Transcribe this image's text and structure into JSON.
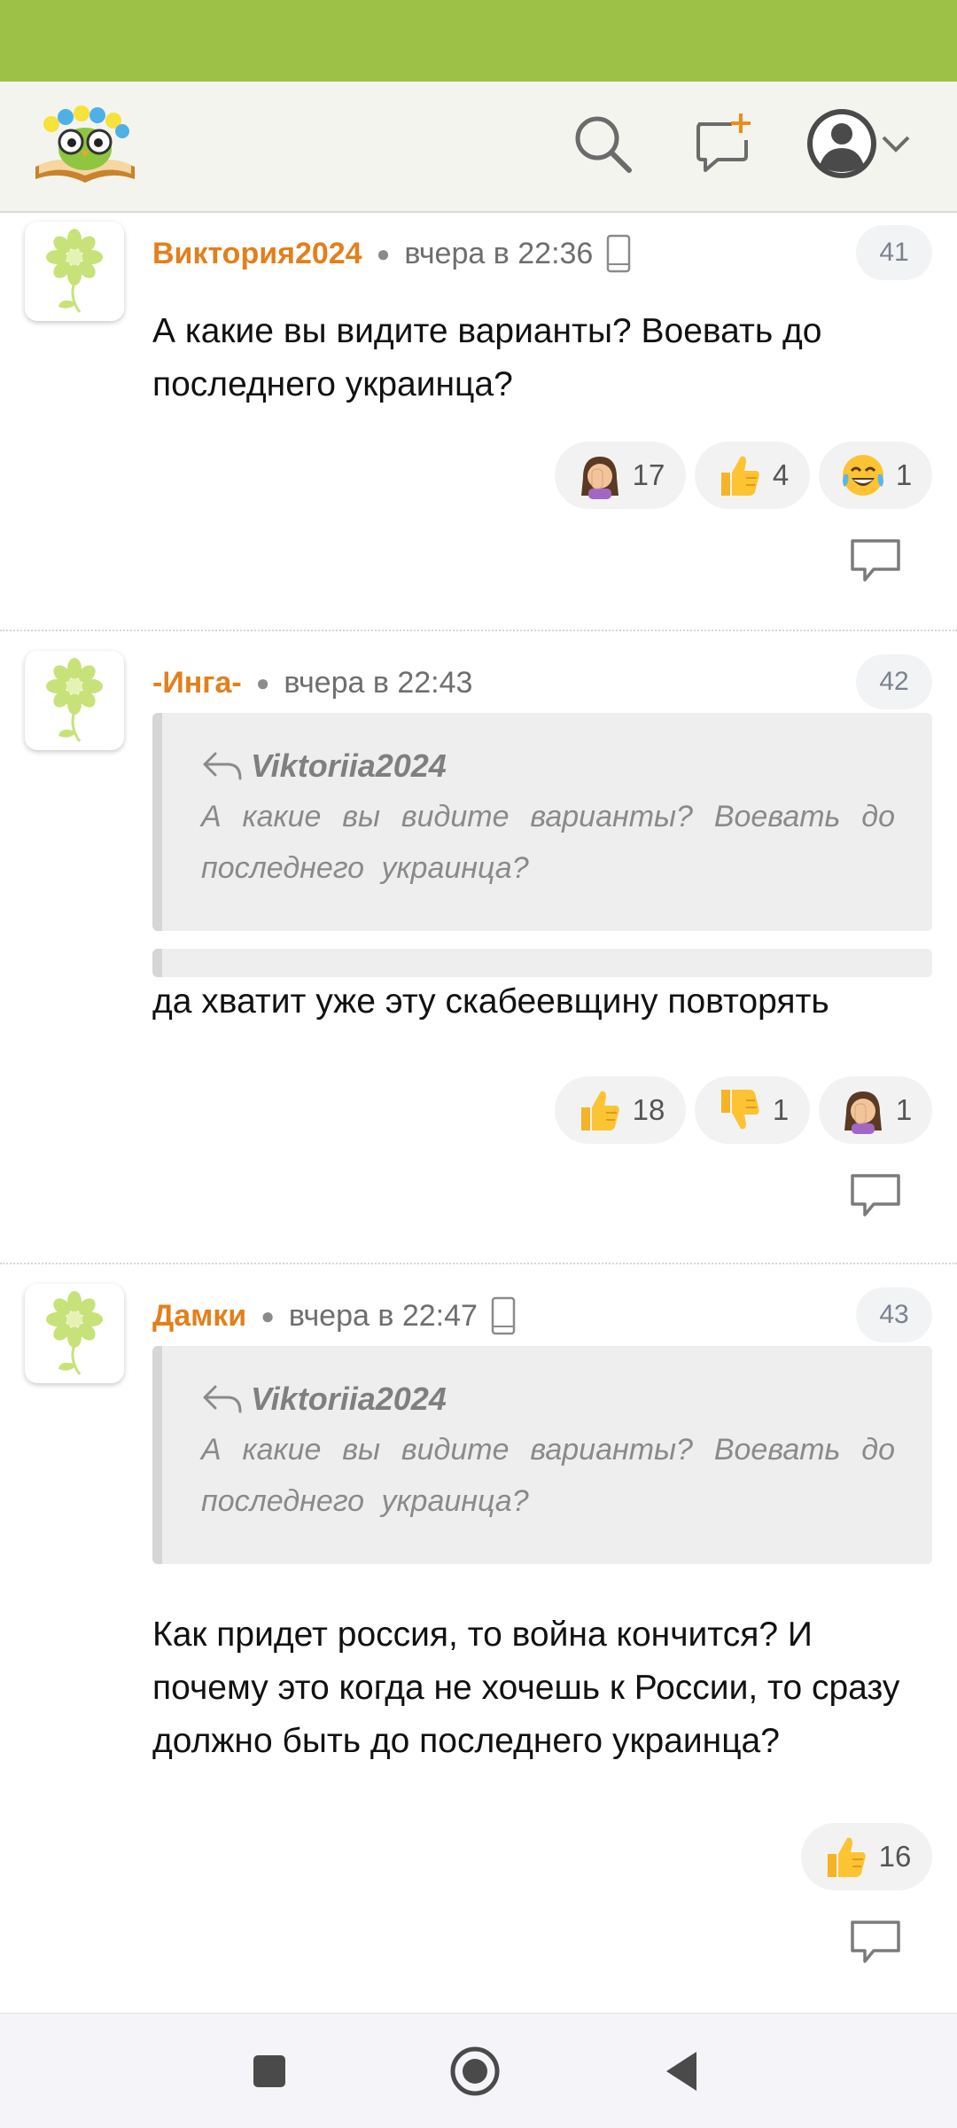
{
  "colors": {
    "statusbar": "#9dc146",
    "author": "#e2801c",
    "header_bg": "#f4f4ee"
  },
  "header": {
    "logo": "owl-on-book-logo",
    "icons": [
      "search-icon",
      "new-message-icon",
      "profile-avatar-icon",
      "chevron-down-icon"
    ]
  },
  "comments": [
    {
      "author": "Виктория2024",
      "time": "вчера в 22:36",
      "device": "phone-icon",
      "number": "41",
      "text": "А какие вы видите варианты? Воевать до последнего украинца?",
      "reactions": [
        {
          "icon": "facepalm-emoji",
          "count": "17"
        },
        {
          "icon": "thumbs-up-emoji",
          "count": "4"
        },
        {
          "icon": "tears-of-joy-emoji",
          "count": "1"
        }
      ]
    },
    {
      "author": "-Инга-",
      "time": "вчера в 22:43",
      "number": "42",
      "quote": {
        "author": "Viktoriia2024",
        "text": "А какие вы видите варианты? Воевать до последнего украинца?"
      },
      "text": "да хватит уже эту скабеевщину повторять",
      "reactions": [
        {
          "icon": "thumbs-up-emoji",
          "count": "18"
        },
        {
          "icon": "thumbs-down-emoji",
          "count": "1"
        },
        {
          "icon": "facepalm-emoji",
          "count": "1"
        }
      ]
    },
    {
      "author": "Дамки",
      "time": "вчера в 22:47",
      "device": "phone-icon",
      "number": "43",
      "quote": {
        "author": "Viktoriia2024",
        "text": "А какие вы видите варианты? Воевать до последнего украинца?"
      },
      "text": "Как придет россия, то война кончится? И почему это когда не хочешь к России, то сразу должно быть до последнего украинца?",
      "reactions": [
        {
          "icon": "thumbs-up-emoji",
          "count": "16"
        }
      ]
    }
  ],
  "navbar": {
    "icons": [
      "recents-square-icon",
      "home-circle-icon",
      "back-triangle-icon"
    ]
  }
}
